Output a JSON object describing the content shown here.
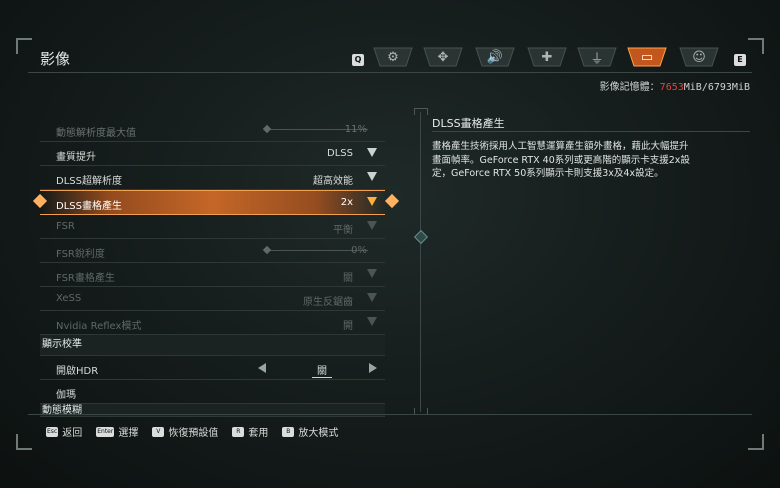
{
  "header": {
    "title": "影像",
    "left_key": "Q",
    "right_key": "E",
    "tabs": [
      {
        "icon": "gear-icon",
        "glyph": "⚙"
      },
      {
        "icon": "gamepad-icon",
        "glyph": "✥"
      },
      {
        "icon": "audio-icon",
        "glyph": "🔊"
      },
      {
        "icon": "move-icon",
        "glyph": "✚"
      },
      {
        "icon": "joystick-icon",
        "glyph": "⏚"
      },
      {
        "icon": "display-icon",
        "glyph": "▭"
      },
      {
        "icon": "accessibility-icon",
        "glyph": "☺"
      }
    ]
  },
  "memory": {
    "label": "影像記憶體：",
    "used": "7653",
    "rest": "MiB/6793MiB",
    "used_color": "#e0463e"
  },
  "settings": {
    "rows": [
      {
        "label": "動態解析度最大值",
        "value": "11%"
      },
      {
        "label": "畫質提升",
        "value": "DLSS"
      },
      {
        "label": "DLSS超解析度",
        "value": "超高效能"
      },
      {
        "label": "DLSS畫格產生",
        "value": "2x"
      },
      {
        "label": "FSR",
        "value": "平衡"
      },
      {
        "label": "FSR銳利度",
        "value": "0%"
      },
      {
        "label": "FSR畫格產生",
        "value": "關"
      },
      {
        "label": "XeSS",
        "value": "原生反鋸齒"
      },
      {
        "label": "Nvidia Reflex模式",
        "value": "開"
      }
    ],
    "section_calibration": "顯示校準",
    "hdr": {
      "label": "開啟HDR",
      "value": "關"
    },
    "gamma": {
      "label": "伽瑪"
    },
    "motion_blur": "動態模糊"
  },
  "description": {
    "title": "DLSS畫格產生",
    "body": "畫格產生技術採用人工智慧運算產生額外畫格，藉此大幅提升畫面幀率。GeForce RTX 40系列或更高階的顯示卡支援2x設定，GeForce RTX 50系列顯示卡則支援3x及4x設定。"
  },
  "footer": [
    {
      "key": "Esc",
      "label": "返回"
    },
    {
      "key": "Enter",
      "label": "選擇"
    },
    {
      "key": "V",
      "label": "恢復預設值"
    },
    {
      "key": "R",
      "label": "套用"
    },
    {
      "key": "B",
      "label": "放大模式"
    }
  ],
  "colors": {
    "accent": "#d8772a",
    "highlight": "#ffb040"
  }
}
